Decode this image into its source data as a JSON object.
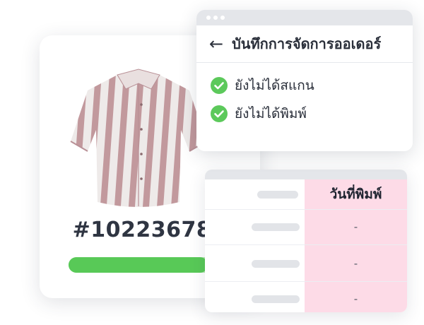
{
  "order_card": {
    "order_number": "#10223678",
    "progress_fraction": 0.84,
    "colors": {
      "progress_fill": "#58c957",
      "progress_track": "#b5e8b0",
      "shirt_stripe": "#c99ea3"
    }
  },
  "order_dialog": {
    "title": "บันทึกการจัดการออเดอร์",
    "status_items": [
      {
        "label": "ยังไม่ได้สแกน",
        "icon": "check-circle-icon"
      },
      {
        "label": "ยังไม่ได้พิมพ์",
        "icon": "check-circle-icon"
      }
    ],
    "colors": {
      "check": "#5cc95b"
    }
  },
  "table": {
    "column_header": "วันที่พิมพ์",
    "rows": [
      {
        "print_date": "-"
      },
      {
        "print_date": "-"
      },
      {
        "print_date": "-"
      }
    ],
    "colors": {
      "highlight_column": "#fddbe7"
    }
  }
}
